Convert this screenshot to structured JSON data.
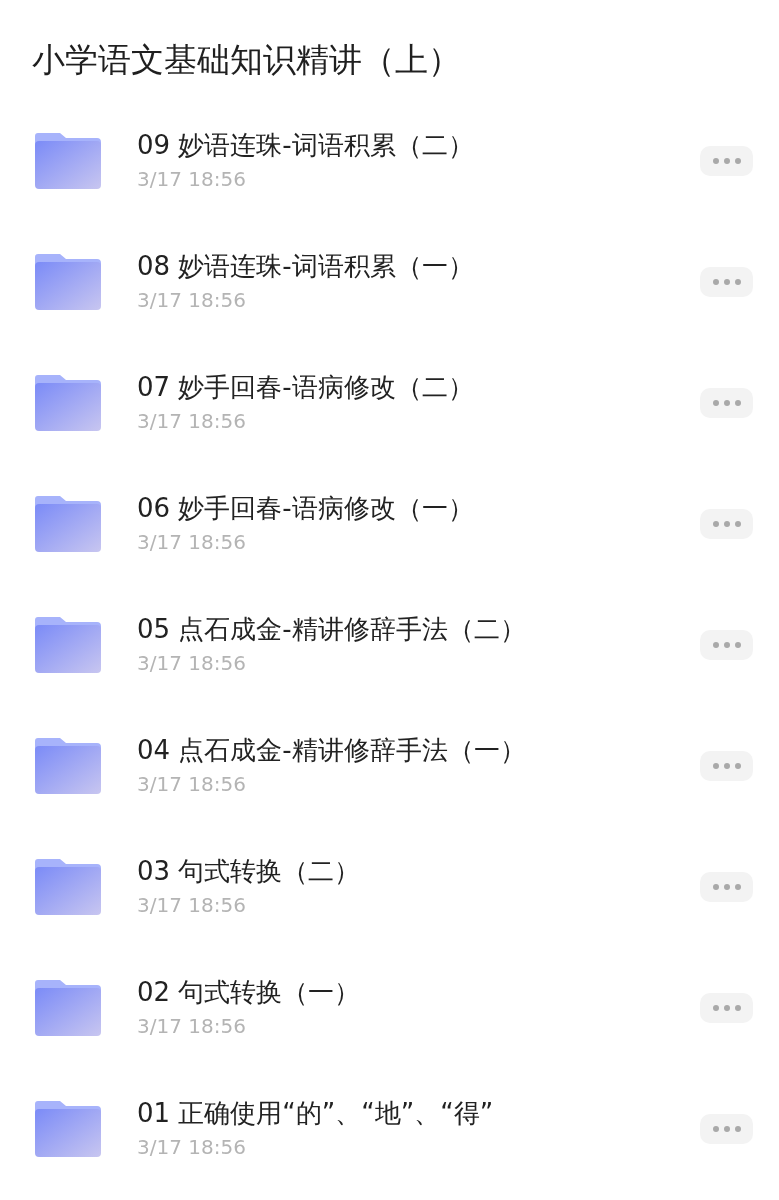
{
  "title": "小学语文基础知识精讲（上）",
  "folders": [
    {
      "name": "09 妙语连珠-词语积累（二）",
      "time": "3/17 18:56"
    },
    {
      "name": "08 妙语连珠-词语积累（一）",
      "time": "3/17 18:56"
    },
    {
      "name": "07 妙手回春-语病修改（二）",
      "time": "3/17 18:56"
    },
    {
      "name": "06 妙手回春-语病修改（一）",
      "time": "3/17 18:56"
    },
    {
      "name": "05 点石成金-精讲修辞手法（二）",
      "time": "3/17 18:56"
    },
    {
      "name": "04 点石成金-精讲修辞手法（一）",
      "time": "3/17 18:56"
    },
    {
      "name": "03 句式转换（二）",
      "time": "3/17 18:56"
    },
    {
      "name": "02 句式转换（一）",
      "time": "3/17 18:56"
    },
    {
      "name": "01 正确使用“的”、“地”、“得”",
      "time": "3/17 18:56"
    }
  ]
}
